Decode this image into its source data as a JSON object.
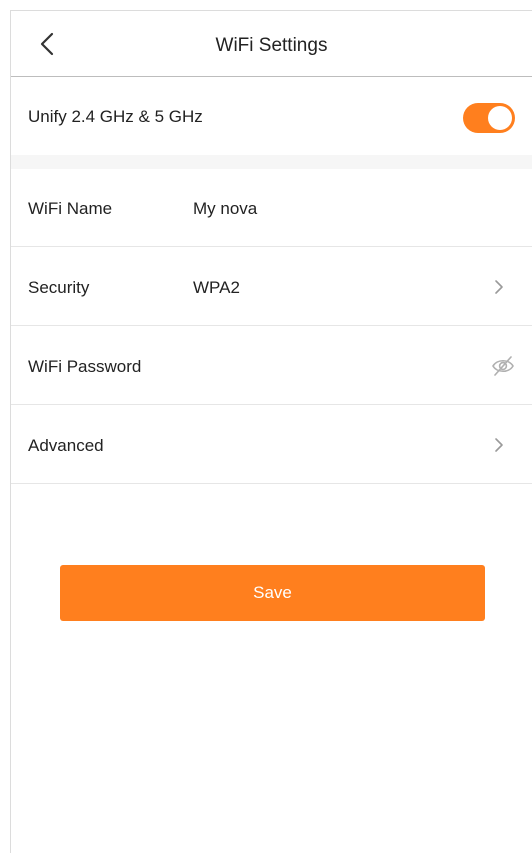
{
  "header": {
    "title": "WiFi Settings",
    "back_icon": "chevron-left-icon"
  },
  "unify": {
    "label": "Unify 2.4 GHz & 5 GHz",
    "enabled": true,
    "accent_color": "#ff7f1e"
  },
  "wifi_name": {
    "label": "WiFi Name",
    "value": "My nova"
  },
  "security": {
    "label": "Security",
    "value": "WPA2",
    "icon": "chevron-right-icon"
  },
  "wifi_password": {
    "label": "WiFi Password",
    "value": "",
    "icon": "eye-off-icon"
  },
  "advanced": {
    "label": "Advanced",
    "icon": "chevron-right-icon"
  },
  "actions": {
    "save_label": "Save",
    "save_color": "#ff7f1e"
  }
}
